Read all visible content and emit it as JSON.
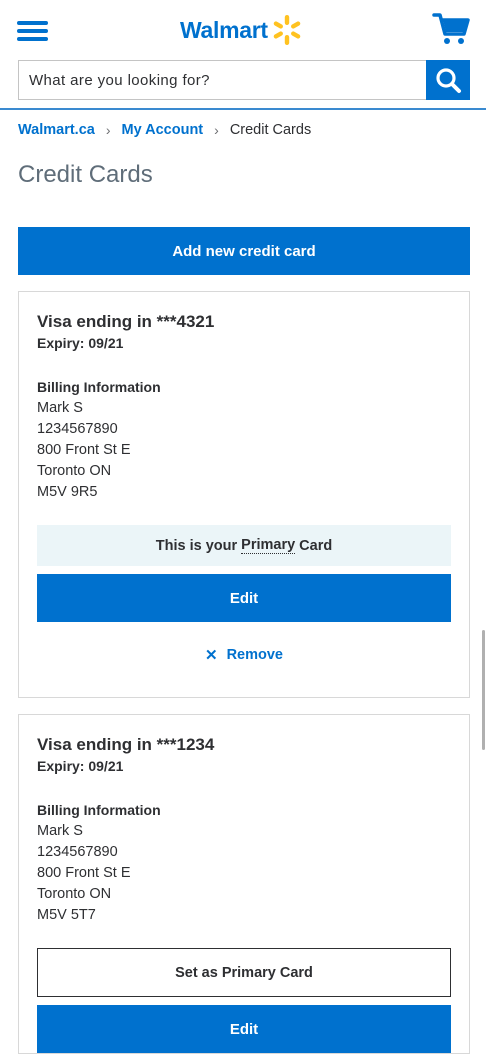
{
  "header": {
    "logo_text": "Walmart",
    "brand_color": "#0071ce",
    "spark_color": "#ffc220"
  },
  "search": {
    "placeholder": "What are you looking for?"
  },
  "breadcrumb": {
    "items": [
      "Walmart.ca",
      "My Account"
    ],
    "separator": "›",
    "current": "Credit Cards"
  },
  "page": {
    "title": "Credit Cards",
    "add_button": "Add new credit card"
  },
  "cards": [
    {
      "title": "Visa ending in ***4321",
      "expiry": "Expiry: 09/21",
      "billing_heading": "Billing Information",
      "name": "Mark S",
      "phone": "1234567890",
      "street": "800 Front St E",
      "city": "Toronto ON",
      "postal": "M5V 9R5",
      "primary_prefix": "This is your",
      "primary_word": "Primary",
      "primary_suffix": "Card",
      "edit_label": "Edit",
      "remove_label": "Remove"
    },
    {
      "title": "Visa ending in ***1234",
      "expiry": "Expiry: 09/21",
      "billing_heading": "Billing Information",
      "name": "Mark S",
      "phone": "1234567890",
      "street": "800 Front St E",
      "city": "Toronto ON",
      "postal": "M5V 5T7",
      "set_primary_label": "Set as Primary Card",
      "edit_label": "Edit"
    }
  ]
}
